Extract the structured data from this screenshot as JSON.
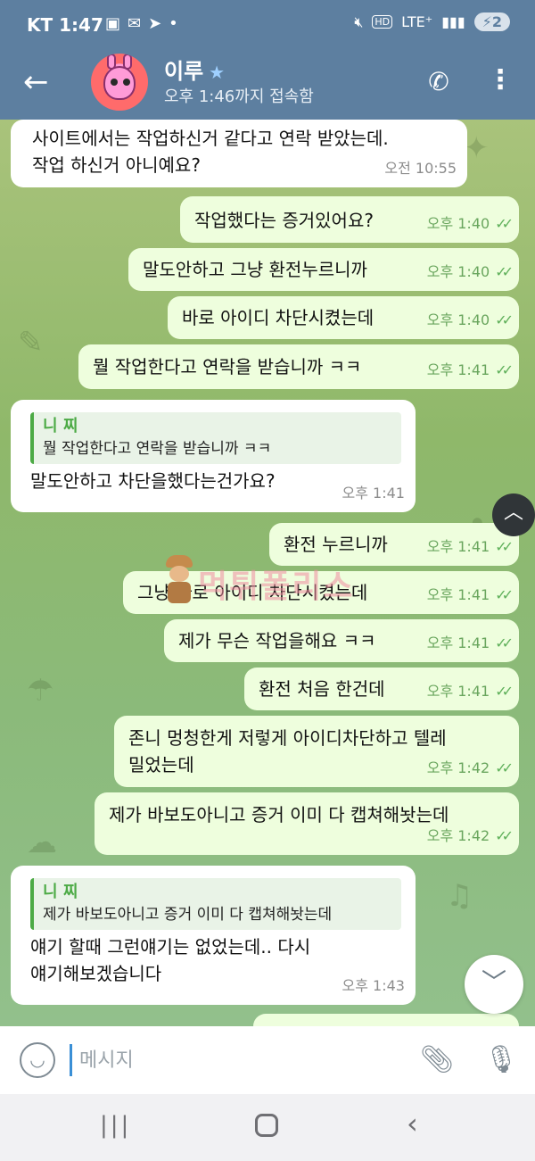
{
  "status_bar": {
    "carrier": "KT",
    "time": "1:47",
    "left_icons": [
      "screenshot-icon",
      "shopping-bag-icon",
      "telegram-icon",
      "dot-icon"
    ],
    "network": "LTE⁺",
    "battery": "2"
  },
  "header": {
    "contact_name": "이루",
    "last_seen": "오후 1:46까지 접속함",
    "icons": [
      "back-arrow-icon",
      "star-icon",
      "phone-icon",
      "more-vert-icon"
    ]
  },
  "messages": [
    {
      "dir": "in",
      "text": "사이트에서는 작업하신거 같다고 연락 받았는데.\n작업 하신거 아니예요?",
      "time": "오전 10:55"
    },
    {
      "dir": "out",
      "text": "작업했다는 증거있어요?",
      "time": "오후 1:40"
    },
    {
      "dir": "out",
      "text": "말도안하고 그냥 환전누르니까",
      "time": "오후 1:40"
    },
    {
      "dir": "out",
      "text": "바로 아이디 차단시켰는데",
      "time": "오후 1:40"
    },
    {
      "dir": "out",
      "text": "뭘 작업한다고 연락을 받습니까 ㅋㅋ",
      "time": "오후 1:41"
    },
    {
      "dir": "in",
      "reply_name": "니 찌",
      "reply_text": "뭘 작업한다고 연락을 받습니까 ㅋㅋ",
      "text": "말도안하고  차단을했다는건가요?",
      "time": "오후 1:41"
    },
    {
      "dir": "out",
      "text": "환전 누르니까",
      "time": "오후 1:41"
    },
    {
      "dir": "out",
      "text": "그냥 바로 아이디 차단시켰는데",
      "time": "오후 1:41"
    },
    {
      "dir": "out",
      "text": "제가 무슨 작업을해요 ㅋㅋ",
      "time": "오후 1:41"
    },
    {
      "dir": "out",
      "text": "환전 처음 한건데",
      "time": "오후 1:41"
    },
    {
      "dir": "out",
      "text": "존니 멍청한게 저렇게 아이디차단하고 텔레\n밀었는데",
      "time": "오후 1:42"
    },
    {
      "dir": "out",
      "text": "제가 바보도아니고 증거 이미 다 캡쳐해놧는데",
      "time": "오후 1:42"
    },
    {
      "dir": "in",
      "reply_name": "니 찌",
      "reply_text": "제가 바보도아니고 증거 이미 다 캡쳐해놧는데",
      "text": "얘기 할때 그런얘기는 없었는데..  다시\n얘기해보겠습니다",
      "time": "오후 1:43"
    }
  ],
  "watermark": {
    "text": "먹튀폴리스"
  },
  "input": {
    "placeholder": "메시지"
  },
  "colors": {
    "header": "#5d7fa0",
    "outgoing": "#eefedd",
    "incoming": "#ffffff",
    "accent": "#4caa45"
  }
}
